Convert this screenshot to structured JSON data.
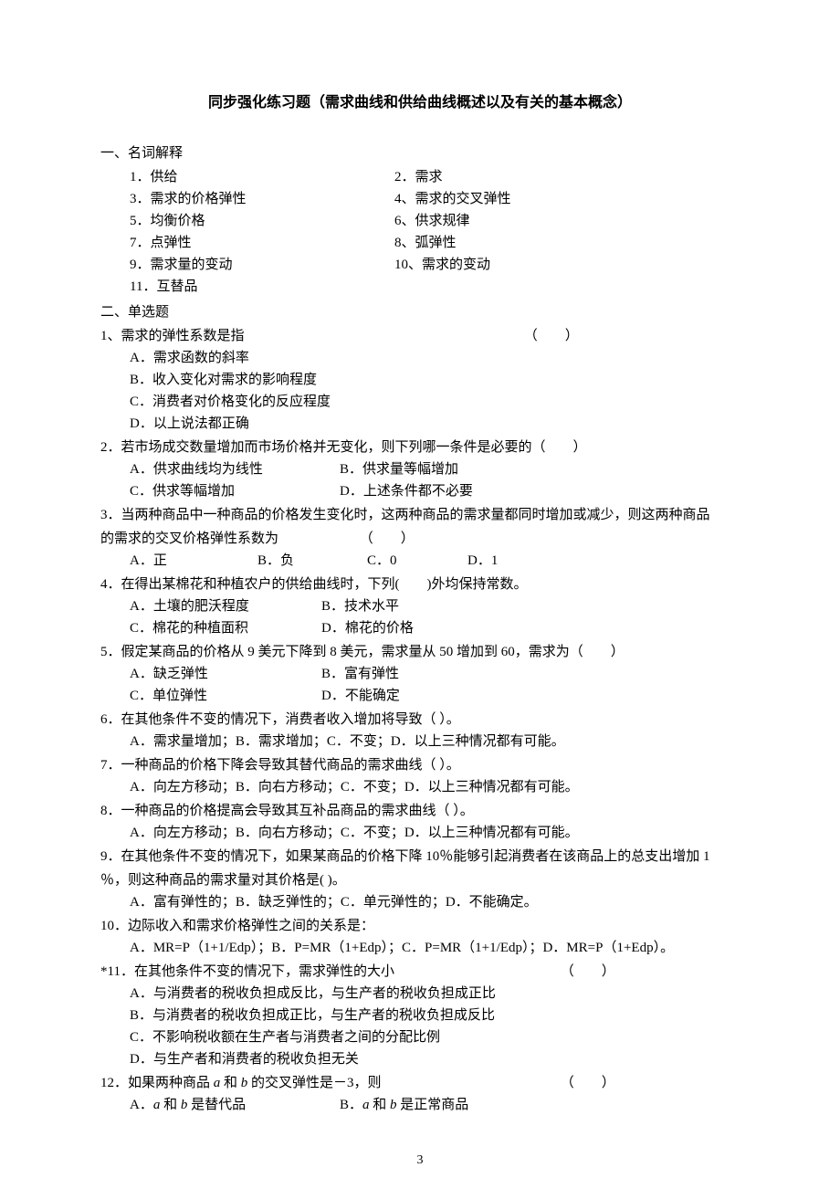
{
  "title": "同步强化练习题（需求曲线和供给曲线概述以及有关的基本概念）",
  "section1": {
    "head": "一、名词解释",
    "terms": [
      {
        "l": "1．供给",
        "r": "2．需求"
      },
      {
        "l": "3．需求的价格弹性",
        "r": "4、需求的交叉弹性"
      },
      {
        "l": "5．均衡价格",
        "r": "6、供求规律"
      },
      {
        "l": "7．点弹性",
        "r": "8、弧弹性"
      },
      {
        "l": "9．需求量的变动",
        "r": "10、需求的变动"
      },
      {
        "l": "11．互替品",
        "r": ""
      }
    ]
  },
  "section2": {
    "head": "二、单选题",
    "q1": {
      "stem": "1、需求的弹性系数是指",
      "paren": "（　　）",
      "a": "A．需求函数的斜率",
      "b": "B．收入变化对需求的影响程度",
      "c": "C．消费者对价格变化的反应程度",
      "d": "D．以上说法都正确"
    },
    "q2": {
      "stem": "2．若市场成交数量增加而市场价格并无变化，则下列哪一条件是必要的（　　）",
      "a": "A．供求曲线均为线性",
      "b": "B．供求量等幅增加",
      "c": "C．供求等幅增加",
      "d": "D．上述条件都不必要"
    },
    "q3": {
      "line1": "3．当两种商品中一种商品的价格发生变化时，这两种商品的需求量都同时增加或减少，则这两种商品",
      "line2": "的需求的交叉价格弹性系数为",
      "paren": "（　　）",
      "a": "A．正",
      "b": "B．负",
      "c": "C．0",
      "d": "D．1"
    },
    "q4": {
      "stem": "4．在得出某棉花和种植农户的供给曲线时，下列(　　)外均保持常数。",
      "a": "A．土壤的肥沃程度",
      "b": "B．技术水平",
      "c": "C．棉花的种植面积",
      "d": "D．棉花的价格"
    },
    "q5": {
      "stem": "5．假定某商品的价格从 9 美元下降到 8 美元，需求量从 50 增加到 60，需求为（　　）",
      "a": "A．缺乏弹性",
      "b": "B．富有弹性",
      "c": "C．单位弹性",
      "d": "D．不能确定"
    },
    "q6": {
      "stem": "6．在其他条件不变的情况下，消费者收入增加将导致（  ）。",
      "opts": "A．需求量增加；B．需求增加；C．不变；D．以上三种情况都有可能。"
    },
    "q7": {
      "stem": "7．一种商品的价格下降会导致其替代商品的需求曲线（  ）。",
      "opts": "A．向左方移动；B．向右方移动；C．不变；D．以上三种情况都有可能。"
    },
    "q8": {
      "stem": "8．一种商品的价格提高会导致其互补品商品的需求曲线（  ）。",
      "opts": "A．向左方移动；B．向右方移动；C．不变；D．以上三种情况都有可能。"
    },
    "q9": {
      "line1": "9．在其他条件不变的情况下，如果某商品的价格下降 10％能够引起消费者在该商品上的总支出增加 1",
      "line2": "％，则这种商品的需求量对其价格是(  )。",
      "opts": "A．富有弹性的；B．缺乏弹性的；C．单元弹性的；D．不能确定。"
    },
    "q10": {
      "stem": "10．边际收入和需求价格弹性之间的关系是：",
      "opts": "A．MR=P（1+1/Edp）；B．P=MR（1+Edp）；C．P=MR（1+1/Edp）；D．MR=P（1+Edp）。"
    },
    "q11": {
      "stem": "*11．在其他条件不变的情况下，需求弹性的大小",
      "paren": "（　　）",
      "a": "A．与消费者的税收负担成反比，与生产者的税收负担成正比",
      "b": "B．与消费者的税收负担成正比，与生产者的税收负担成反比",
      "c": "C．不影响税收额在生产者与消费者之间的分配比例",
      "d": "D．与生产者和消费者的税收负担无关"
    },
    "q12": {
      "stem_pre": "12．如果两种商品 ",
      "stem_a": "a",
      "stem_mid": " 和 ",
      "stem_b": "b",
      "stem_post": " 的交叉弹性是－3，则",
      "paren": "（　　）",
      "a_pre": "A．",
      "a_a": "a",
      "a_mid": " 和 ",
      "a_b": "b",
      "a_post": " 是替代品",
      "b_pre": "B．",
      "b_a": "a",
      "b_mid": " 和 ",
      "b_b": "b",
      "b_post": " 是正常商品"
    }
  },
  "page_number": "3"
}
